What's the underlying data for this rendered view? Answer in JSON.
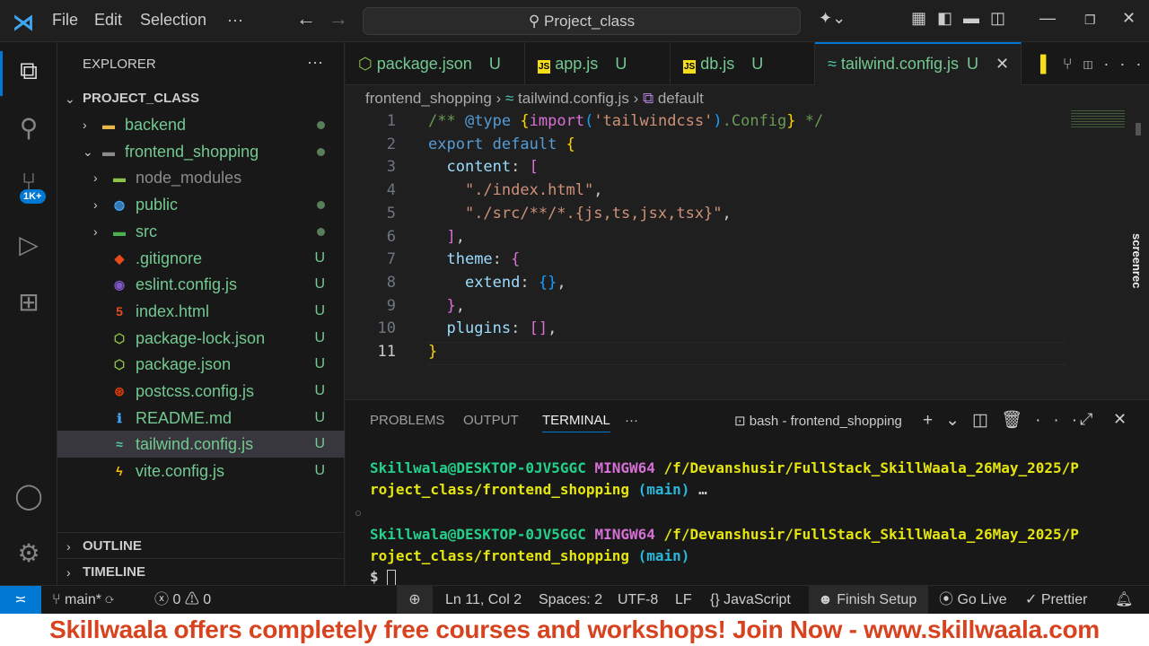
{
  "titlebar": {
    "menus": [
      "File",
      "Edit",
      "Selection",
      "···"
    ],
    "search": "Project_class"
  },
  "sidebar": {
    "title": "EXPLORER",
    "more": "···",
    "root": "PROJECT_CLASS",
    "items": [
      {
        "label": "backend",
        "indent": 1,
        "folder": true,
        "icon": "folder-icon",
        "status": "dot"
      },
      {
        "label": "frontend_shopping",
        "indent": 1,
        "folder": true,
        "open": true,
        "icon": "folder-open-icon",
        "status": "dot"
      },
      {
        "label": "node_modules",
        "indent": 2,
        "folder": true,
        "icon": "folder-node-icon",
        "status": "",
        "dim": true
      },
      {
        "label": "public",
        "indent": 2,
        "folder": true,
        "icon": "folder-public-icon",
        "status": "dot"
      },
      {
        "label": "src",
        "indent": 2,
        "folder": true,
        "icon": "folder-src-icon",
        "status": "dot"
      },
      {
        "label": ".gitignore",
        "indent": 2,
        "icon": "git-icon",
        "status": "U"
      },
      {
        "label": "eslint.config.js",
        "indent": 2,
        "icon": "eslint-icon",
        "status": "U"
      },
      {
        "label": "index.html",
        "indent": 2,
        "icon": "html-icon",
        "status": "U"
      },
      {
        "label": "package-lock.json",
        "indent": 2,
        "icon": "nodejs-icon",
        "status": "U"
      },
      {
        "label": "package.json",
        "indent": 2,
        "icon": "nodejs-icon",
        "status": "U"
      },
      {
        "label": "postcss.config.js",
        "indent": 2,
        "icon": "postcss-icon",
        "status": "U"
      },
      {
        "label": "README.md",
        "indent": 2,
        "icon": "info-icon",
        "status": "U"
      },
      {
        "label": "tailwind.config.js",
        "indent": 2,
        "icon": "tailwind-icon",
        "status": "U",
        "selected": true
      },
      {
        "label": "vite.config.js",
        "indent": 2,
        "icon": "vite-icon",
        "status": "U"
      }
    ],
    "outline": "OUTLINE",
    "timeline": "TIMELINE"
  },
  "tabs": [
    {
      "label": "package.json",
      "status": "U",
      "icon": "nodejs-icon"
    },
    {
      "label": "app.js",
      "status": "U",
      "icon": "js-icon"
    },
    {
      "label": "db.js",
      "status": "U",
      "icon": "js-icon"
    },
    {
      "label": "tailwind.config.js",
      "status": "U",
      "icon": "tailwind-icon",
      "active": true
    }
  ],
  "breadcrumb": [
    "frontend_shopping",
    "tailwind.config.js",
    "default"
  ],
  "code": [
    [
      [
        "/** ",
        "cm"
      ],
      [
        "@type",
        "kb"
      ],
      [
        " ",
        "cm"
      ],
      [
        "{",
        "b1"
      ],
      [
        "import",
        "b2"
      ],
      [
        "(",
        "b3"
      ],
      [
        "'tailwindcss'",
        "str"
      ],
      [
        ")",
        "b3"
      ],
      [
        ".Config",
        "cm"
      ],
      [
        "}",
        "b1"
      ],
      [
        " */",
        "cm"
      ]
    ],
    [
      [
        "export ",
        "kb"
      ],
      [
        "default ",
        "kb"
      ],
      [
        "{",
        "b1"
      ]
    ],
    [
      [
        "  "
      ],
      [
        "content",
        "pr"
      ],
      [
        ": ",
        "pl"
      ],
      [
        "[",
        "b2"
      ]
    ],
    [
      [
        "    "
      ],
      [
        "\"./index.html\"",
        "str"
      ],
      [
        ",",
        "pl"
      ]
    ],
    [
      [
        "    "
      ],
      [
        "\"./src/**/*.{js,ts,jsx,tsx}\"",
        "str"
      ],
      [
        ",",
        "pl"
      ]
    ],
    [
      [
        "  "
      ],
      [
        "]",
        "b2"
      ],
      [
        ",",
        "pl"
      ]
    ],
    [
      [
        "  "
      ],
      [
        "theme",
        "pr"
      ],
      [
        ": ",
        "pl"
      ],
      [
        "{",
        "b2"
      ]
    ],
    [
      [
        "    "
      ],
      [
        "extend",
        "pr"
      ],
      [
        ": ",
        "pl"
      ],
      [
        "{}",
        "b3"
      ],
      [
        ",",
        "pl"
      ]
    ],
    [
      [
        "  "
      ],
      [
        "}",
        "b2"
      ],
      [
        ",",
        "pl"
      ]
    ],
    [
      [
        "  "
      ],
      [
        "plugins",
        "pr"
      ],
      [
        ": ",
        "pl"
      ],
      [
        "[]",
        "b2"
      ],
      [
        ",",
        "pl"
      ]
    ],
    [
      [
        "}",
        "b1"
      ]
    ]
  ],
  "panel": {
    "tabs": [
      "PROBLEMS",
      "OUTPUT",
      "TERMINAL",
      "···"
    ],
    "terminal_name": "bash - frontend_shopping",
    "prompt": {
      "user": "Skillwala@DESKTOP-0JV5GGC",
      "sys": "MINGW64",
      "path1": "/f/Devanshusir/FullStack_SkillWaala_26May_2025/P",
      "path2": "roject_class/frontend_shopping",
      "branch": "(main)",
      "ellipsis": "…"
    },
    "dollar": "$"
  },
  "status": {
    "branch": "main*",
    "errors": "0",
    "warnings": "0",
    "position": "Ln 11, Col 2",
    "spaces": "Spaces: 2",
    "encoding": "UTF-8",
    "eol": "LF",
    "language": "JavaScript",
    "finish": "Finish Setup",
    "golive": "Go Live",
    "prettier": "Prettier"
  },
  "activity": {
    "badge": "1K+"
  },
  "watermark": "screenrec",
  "banner": "Skillwaala offers completely free courses and workshops! Join Now - www.skillwaala.com"
}
